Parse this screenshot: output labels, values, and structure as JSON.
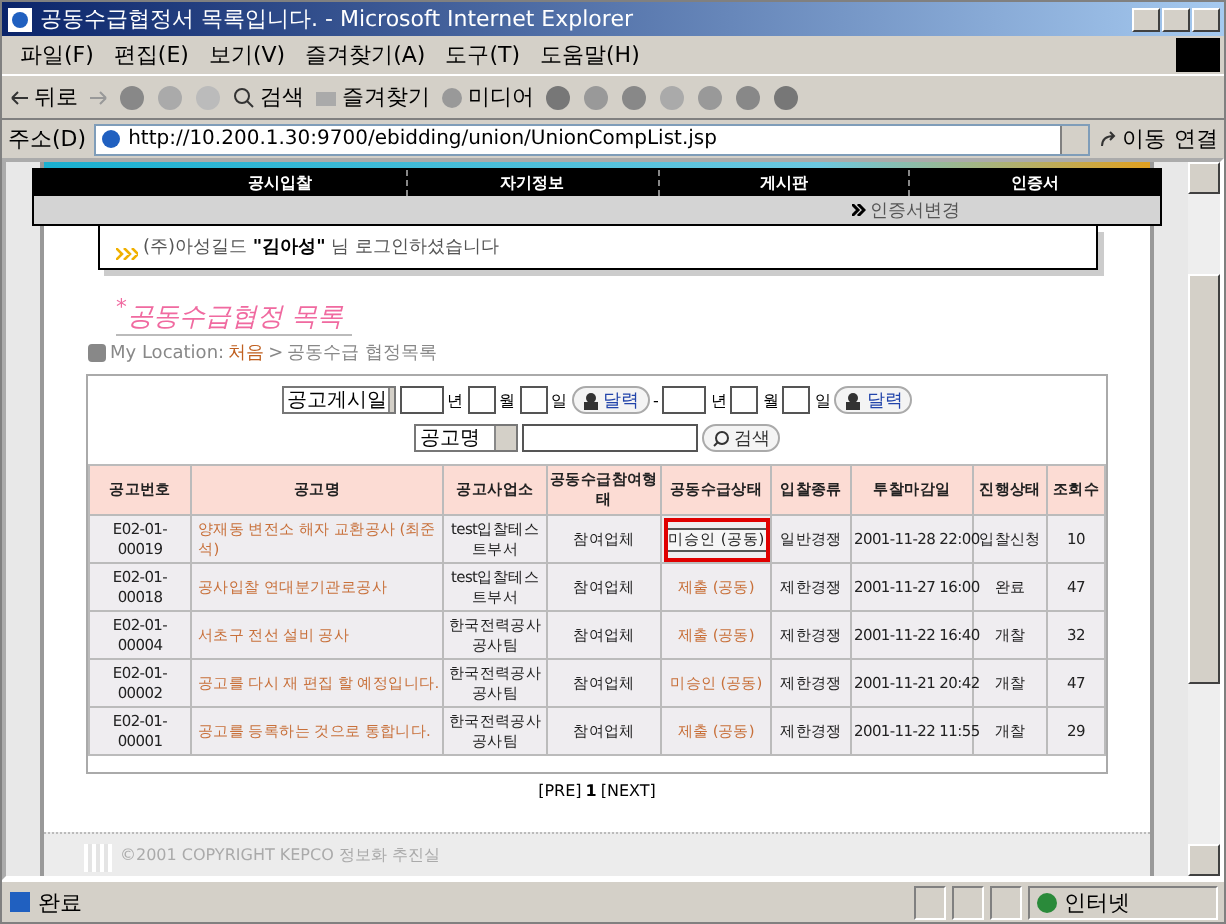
{
  "window": {
    "title": "공동수급협정서 목록입니다. - Microsoft Internet Explorer"
  },
  "menu": [
    "파일(F)",
    "편집(E)",
    "보기(V)",
    "즐겨찾기(A)",
    "도구(T)",
    "도움말(H)"
  ],
  "toolbar": {
    "back": "뒤로",
    "search": "검색",
    "favorites": "즐겨찾기",
    "media": "미디어"
  },
  "address": {
    "label": "주소(D)",
    "url": "http://10.200.1.30:9700/ebidding/union/UnionCompList.jsp",
    "go": "이동",
    "links": "연결"
  },
  "nav": [
    "공시입찰",
    "자기정보",
    "게시판",
    "인증서"
  ],
  "sub_link": "인증서변경",
  "login": {
    "company": "(주)아성길드",
    "name": "\"김아성\"",
    "suffix": "님 로그인하셨습니다"
  },
  "page_title": "$^{*}$공동수급협정 목록",
  "location": {
    "label": "My Location:",
    "home": "처음",
    "separator": ">",
    "current": "공동수급 협정목록"
  },
  "search": {
    "date_type": "공고게시일",
    "from": {
      "year": "년",
      "month": "월",
      "day": "일",
      "calendar": "달력"
    },
    "range": "-",
    "to": {
      "year": "년",
      "month": "월",
      "day": "일",
      "calendar": "달력"
    },
    "field_type": "공고명",
    "button": "검색"
  },
  "table": {
    "columns": [
      "공고번호",
      "공고명",
      "공고사업소",
      "공동수급참여형태",
      "공동수급상태",
      "입찰종류",
      "투찰마감일",
      "진행상태",
      "조회수"
    ],
    "rows": [
      {
        "number": "E02-01-00019",
        "name": "양재동 변전소 해자 교환공사 (최준석)",
        "office": "test입찰테스트부서",
        "role": "참여업체",
        "status": {
          "text": "미승인 (공동)",
          "kind": "button"
        },
        "type": "일반경쟁",
        "deadline": "2001-11-28 22:00",
        "progress": "입찰신청",
        "views": "10",
        "highlighted": true
      },
      {
        "number": "E02-01-00018",
        "name": "공사입찰 연대분기관로공사",
        "office": "test입찰테스트부서",
        "role": "참여업체",
        "status": {
          "text": "제출 (공동)",
          "kind": "link"
        },
        "type": "제한경쟁",
        "deadline": "2001-11-27 16:00",
        "progress": "완료",
        "views": "47",
        "highlighted": false
      },
      {
        "number": "E02-01-00004",
        "name": "서초구 전선 설비 공사",
        "office": "한국전력공사 공사팀",
        "role": "참여업체",
        "status": {
          "text": "제출 (공동)",
          "kind": "link"
        },
        "type": "제한경쟁",
        "deadline": "2001-11-22 16:40",
        "progress": "개찰",
        "views": "32",
        "highlighted": false
      },
      {
        "number": "E02-01-00002",
        "name": "공고를 다시 재 편집 할 예정입니다.",
        "office": "한국전력공사 공사팀",
        "role": "참여업체",
        "status": {
          "text": "미승인 (공동)",
          "kind": "link"
        },
        "type": "제한경쟁",
        "deadline": "2001-11-21 20:42",
        "progress": "개찰",
        "views": "47",
        "highlighted": false
      },
      {
        "number": "E02-01-00001",
        "name": "공고를 등록하는 것으로 통합니다.",
        "office": "한국전력공사 공사팀",
        "role": "참여업체",
        "status": {
          "text": "제출 (공동)",
          "kind": "link"
        },
        "type": "제한경쟁",
        "deadline": "2001-11-22 11:55",
        "progress": "개찰",
        "views": "29",
        "highlighted": false
      }
    ]
  },
  "pagination": {
    "prev": "[PRE]",
    "current": "1",
    "next": "[NEXT]"
  },
  "footer": "©2001 COPYRIGHT KEPCO 정보화 추진실",
  "status_bar": {
    "text": "완료",
    "zone": "인터넷"
  }
}
